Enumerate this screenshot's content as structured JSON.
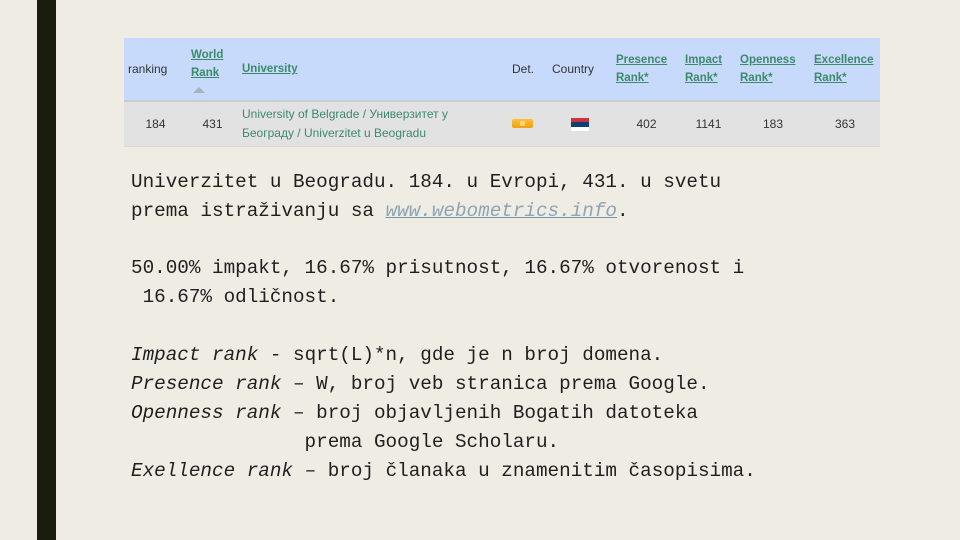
{
  "table": {
    "headers": {
      "ranking": "ranking",
      "world_rank_line1": "World",
      "world_rank_line2": "Rank",
      "university": "University",
      "det": "Det.",
      "country": "Country",
      "presence_line1": "Presence",
      "presence_line2": "Rank*",
      "impact_line1": "Impact",
      "impact_line2": "Rank*",
      "openness_line1": "Openness",
      "openness_line2": "Rank*",
      "excellence_line1": "Excellence",
      "excellence_line2": "Rank*"
    },
    "sort_icon": "sort-ascending-icon",
    "row": {
      "ranking": "184",
      "world_rank": "431",
      "university_line1": "University of Belgrade / Универзитет у",
      "university_line2": "Београду / Univerzitet u Beogradu",
      "det_icon": "details-badge-icon",
      "country_flag": "serbia-flag-icon",
      "presence_rank": "402",
      "impact_rank": "1141",
      "openness_rank": "183",
      "excellence_rank": "363"
    },
    "colors": {
      "header_bg": "#c7dafc",
      "row_bg": "#e2e2e2",
      "link": "#3d8a6b",
      "flag_red": "#c6363c",
      "flag_blue": "#0c4077",
      "flag_white": "#ffffff"
    }
  },
  "paragraph1": {
    "line1": "Univerzitet u Beogradu. 184. u Evropi, 431. u svetu",
    "line2_prefix": "prema istraživanju sa ",
    "link": "www.webometrics.info",
    "line2_suffix": "."
  },
  "paragraph2": {
    "line1": "50.00% impakt, 16.67% prisutnost, 16.67% otvorenost i",
    "line2": " 16.67% odličnost."
  },
  "paragraph3": {
    "impact_term": "Impact rank",
    "impact_def": " - sqrt(L)*n, gde je n broj domena.",
    "presence_term": "Presence rank",
    "presence_def": " – W, broj veb stranica prema Google.",
    "openness_term": "Openness rank",
    "openness_def": " – broj objavljenih Bogatih datoteka",
    "openness_def_cont": "               prema Google Scholaru.",
    "excellence_term": "Exellence rank",
    "excellence_def": " – broj članaka u znamenitim časopisima."
  }
}
